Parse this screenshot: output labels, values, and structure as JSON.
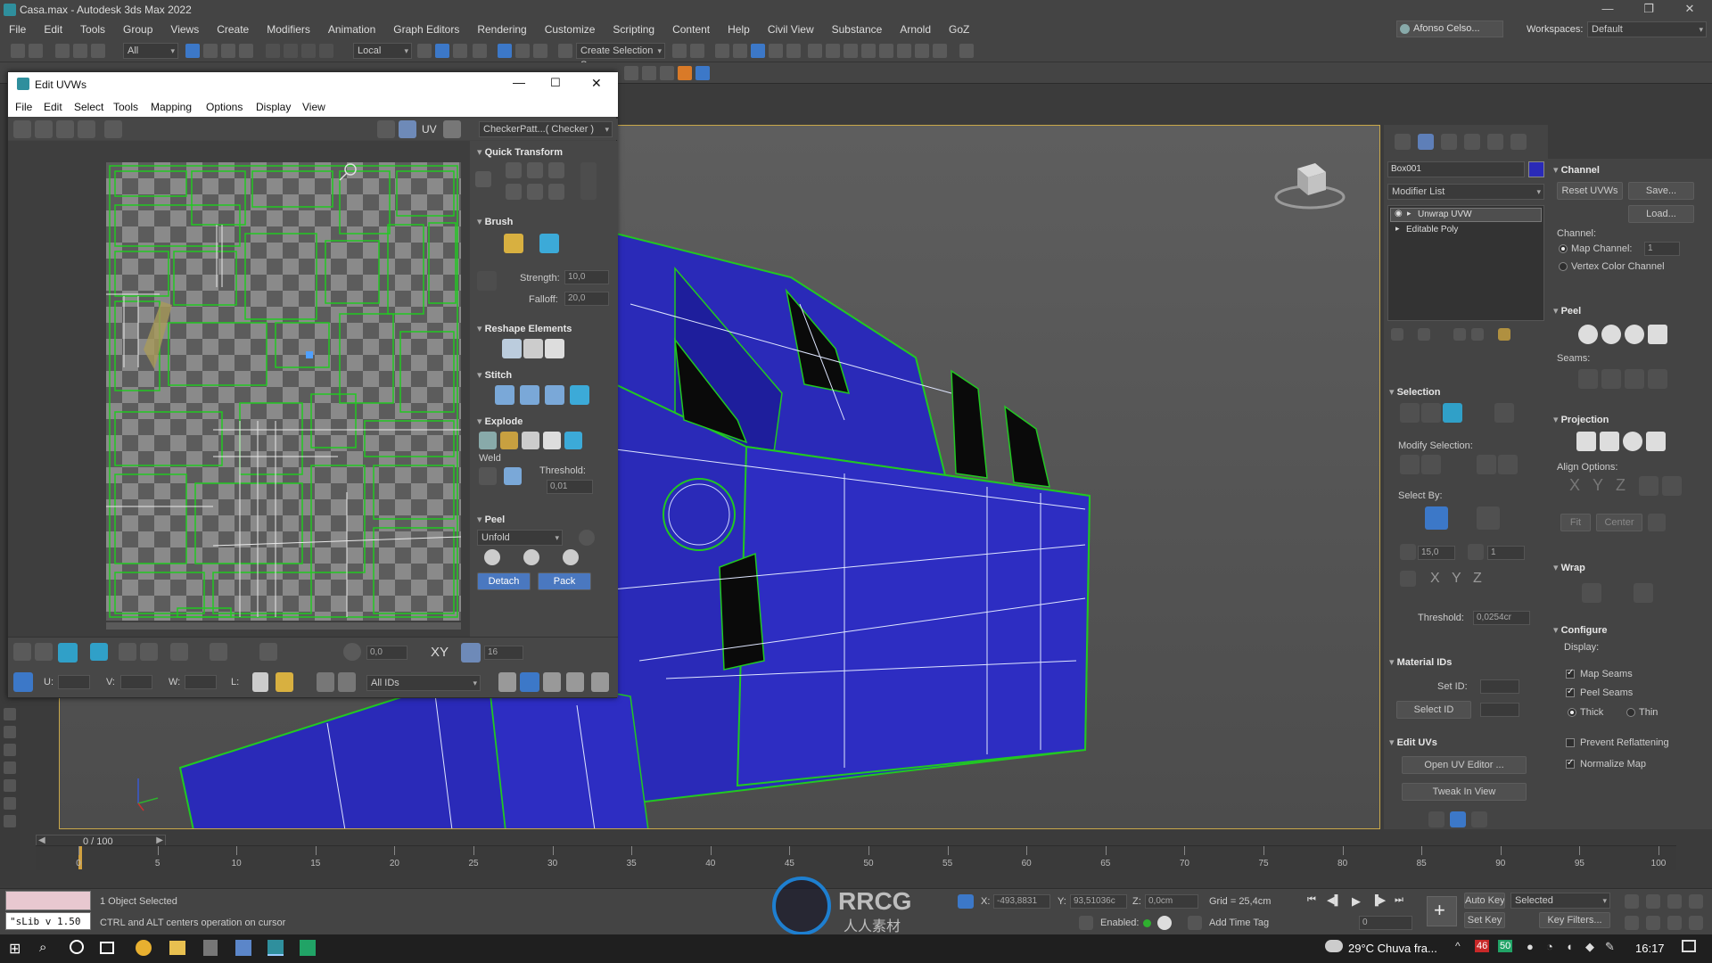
{
  "window": {
    "title": "Casa.max - Autodesk 3ds Max 2022",
    "minimize": "—",
    "maximize": "❐",
    "close": "✕"
  },
  "menu": [
    "File",
    "Edit",
    "Tools",
    "Group",
    "Views",
    "Create",
    "Modifiers",
    "Animation",
    "Graph Editors",
    "Rendering",
    "Customize",
    "Scripting",
    "Content",
    "Help",
    "Civil View",
    "Substance",
    "Arnold",
    "GoZ"
  ],
  "user": {
    "name": "Afonso Celso...",
    "workspaces_label": "Workspaces:",
    "workspace": "Default"
  },
  "toolbar": {
    "filter": "All",
    "coord": "Local",
    "selection_set": "Create Selection Se"
  },
  "uvw_editor": {
    "title": "Edit UVWs",
    "menu": [
      "File",
      "Edit",
      "Select",
      "Tools",
      "Mapping",
      "Options",
      "Display",
      "View"
    ],
    "uv_label": "UV",
    "checker": "CheckerPatt...( Checker )",
    "sections": {
      "quick_transform": "Quick Transform",
      "brush": "Brush",
      "strength_label": "Strength:",
      "strength": "10,0",
      "falloff_label": "Falloff:",
      "falloff": "20,0",
      "reshape": "Reshape Elements",
      "stitch": "Stitch",
      "explode": "Explode",
      "weld": "Weld",
      "threshold_label": "Threshold:",
      "threshold": "0,01",
      "peel": "Peel",
      "unfold": "Unfold",
      "detach": "Detach",
      "pack": "Pack"
    },
    "bottom": {
      "u_label": "U:",
      "v_label": "V:",
      "w_label": "W:",
      "l_label": "L:",
      "ids": "All IDs",
      "spin1": "0,0",
      "xy": "XY",
      "grid": "16"
    }
  },
  "command_panel": {
    "object_name": "Box001",
    "modifier_list": "Modifier List",
    "stack": [
      "Unwrap UVW",
      "Editable Poly"
    ],
    "selection": {
      "title": "Selection",
      "modify_selection": "Modify Selection:",
      "select_by": "Select By:",
      "angle": "15,0",
      "count": "1",
      "threshold_label": "Threshold:",
      "threshold": "0,0254cr"
    },
    "material_ids": {
      "title": "Material IDs",
      "set_id": "Set ID:",
      "select_id": "Select ID"
    },
    "edit_uvs": {
      "title": "Edit UVs",
      "open_editor": "Open UV Editor ...",
      "tweak": "Tweak In View"
    }
  },
  "right_panel": {
    "channel": {
      "title": "Channel",
      "reset": "Reset UVWs",
      "save": "Save...",
      "load": "Load...",
      "channel_label": "Channel:",
      "map_channel": "Map Channel:",
      "map_channel_value": "1",
      "vertex_color": "Vertex Color Channel"
    },
    "peel": {
      "title": "Peel",
      "seams": "Seams:"
    },
    "projection": {
      "title": "Projection",
      "align_options": "Align Options:",
      "axes": [
        "X",
        "Y",
        "Z"
      ],
      "fit": "Fit",
      "center": "Center"
    },
    "wrap": {
      "title": "Wrap"
    },
    "configure": {
      "title": "Configure",
      "display": "Display:",
      "map_seams": "Map Seams",
      "peel_seams": "Peel Seams",
      "thick": "Thick",
      "thin": "Thin",
      "prevent": "Prevent Reflattening",
      "normalize": "Normalize Map"
    }
  },
  "timeline": {
    "frame": "0 / 100",
    "ticks": [
      0,
      5,
      10,
      15,
      20,
      25,
      30,
      35,
      40,
      45,
      50,
      55,
      60,
      65,
      70,
      75,
      80,
      85,
      90,
      95,
      100
    ]
  },
  "status": {
    "maxscript": "\"sLib v 1.50",
    "selected": "1 Object Selected",
    "hint": "CTRL and ALT centers operation on cursor",
    "x_label": "X:",
    "x": "-493,8831",
    "y_label": "Y:",
    "y": "93,51036c",
    "z_label": "Z:",
    "z": "0,0cm",
    "grid": "Grid = 25,4cm",
    "enabled": "Enabled:",
    "add_time_tag": "Add Time Tag",
    "auto_key": "Auto Key",
    "set_key": "Set Key",
    "selected_dd": "Selected",
    "key_filters": "Key Filters...",
    "frame_field": "0",
    "watermark": "RRCG",
    "watermark_sub": "人人素材"
  },
  "taskbar": {
    "weather": "29°C  Chuva fra...",
    "time": "16:17",
    "badge1": "46",
    "badge2": "50"
  },
  "colors": {
    "accent_blue": "#2a2ab8",
    "uv_green": "#22c822",
    "viewport_border": "#c9a84a"
  }
}
